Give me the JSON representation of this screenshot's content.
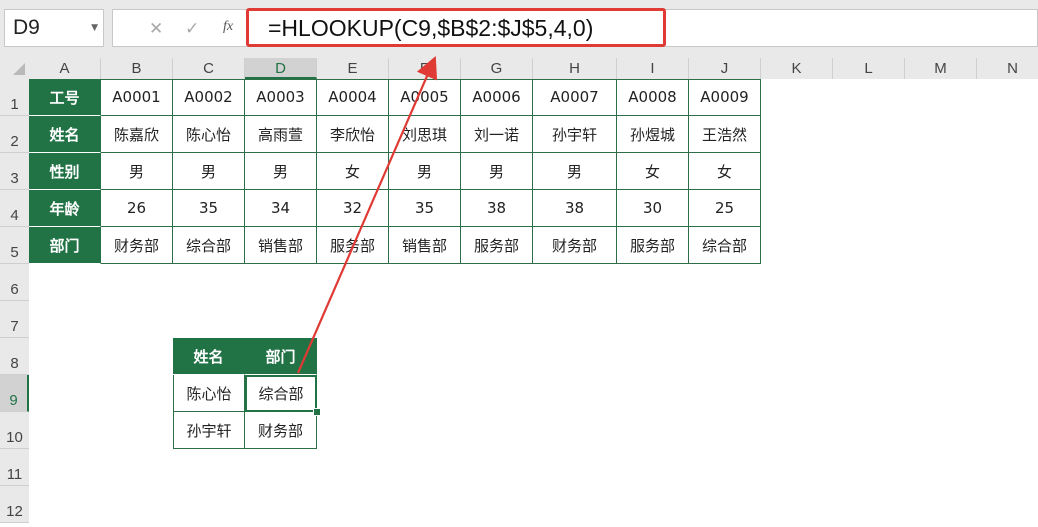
{
  "name_box": "D9",
  "formula": "=HLOOKUP(C9,$B$2:$J$5,4,0)",
  "fx_label": "fx",
  "columns": [
    "A",
    "B",
    "C",
    "D",
    "E",
    "F",
    "G",
    "H",
    "I",
    "J",
    "K",
    "L",
    "M",
    "N"
  ],
  "rows": [
    "1",
    "2",
    "3",
    "4",
    "5",
    "6",
    "7",
    "8",
    "9",
    "10",
    "11",
    "12"
  ],
  "table1": {
    "labels": [
      "工号",
      "姓名",
      "性别",
      "年龄",
      "部门"
    ],
    "data": [
      [
        "A0001",
        "A0002",
        "A0003",
        "A0004",
        "A0005",
        "A0006",
        "A0007",
        "A0008",
        "A0009"
      ],
      [
        "陈嘉欣",
        "陈心怡",
        "高雨萱",
        "李欣怡",
        "刘思琪",
        "刘一诺",
        "孙宇轩",
        "孙煜城",
        "王浩然"
      ],
      [
        "男",
        "男",
        "男",
        "女",
        "男",
        "男",
        "男",
        "女",
        "女"
      ],
      [
        "26",
        "35",
        "34",
        "32",
        "35",
        "38",
        "38",
        "30",
        "25"
      ],
      [
        "财务部",
        "综合部",
        "销售部",
        "服务部",
        "销售部",
        "服务部",
        "财务部",
        "服务部",
        "综合部"
      ]
    ]
  },
  "table2": {
    "headers": [
      "姓名",
      "部门"
    ],
    "rows": [
      [
        "陈心怡",
        "综合部"
      ],
      [
        "孙宇轩",
        "财务部"
      ]
    ]
  },
  "colors": {
    "header_green": "#217346",
    "annotation_red": "#e03a35"
  }
}
